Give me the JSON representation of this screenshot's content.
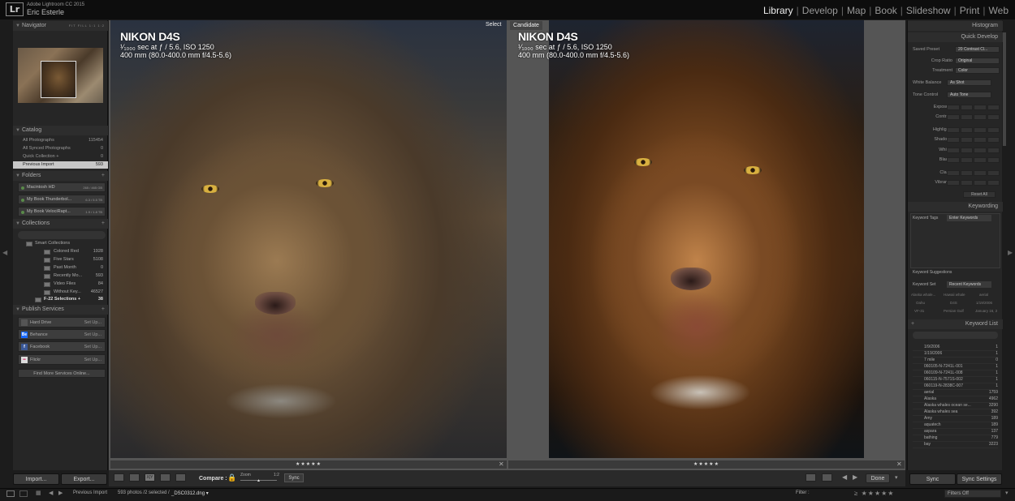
{
  "app": {
    "logo": "Lr",
    "title": "Adobe Lightroom CC 2015",
    "user": "Eric Esterle"
  },
  "modules": [
    {
      "label": "Library",
      "active": true
    },
    {
      "label": "Develop"
    },
    {
      "label": "Map"
    },
    {
      "label": "Book"
    },
    {
      "label": "Slideshow"
    },
    {
      "label": "Print"
    },
    {
      "label": "Web"
    }
  ],
  "navigator": {
    "title": "Navigator",
    "modes": "FIT FILL 1:1 1:2"
  },
  "catalog": {
    "title": "Catalog",
    "items": [
      {
        "label": "All Photographs",
        "count": "115454"
      },
      {
        "label": "All Synced Photographs",
        "count": "0"
      },
      {
        "label": "Quick Collection +",
        "count": "0"
      },
      {
        "label": "Previous Import",
        "count": "593",
        "selected": true
      }
    ]
  },
  "folders": {
    "title": "Folders",
    "items": [
      {
        "label": "Macintosh HD",
        "size": "265 / 465 GB"
      },
      {
        "label": "My Book Thunderbol...",
        "size": "6.3 / 5.5 TB"
      },
      {
        "label": "My Book VelociRapt...",
        "size": "1.9 / 1.8 TB"
      }
    ]
  },
  "collections": {
    "title": "Collections",
    "items": [
      {
        "label": "Smart Collections",
        "count": "",
        "indent": 1
      },
      {
        "label": "Colored Red",
        "count": "1928",
        "indent": 2
      },
      {
        "label": "Five Stars",
        "count": "5108",
        "indent": 2
      },
      {
        "label": "Past Month",
        "count": "0",
        "indent": 2
      },
      {
        "label": "Recently Mo...",
        "count": "593",
        "indent": 2
      },
      {
        "label": "Video Files",
        "count": "84",
        "indent": 2
      },
      {
        "label": "Without Key...",
        "count": "46527",
        "indent": 2
      },
      {
        "label": "F-22 Selections +",
        "count": "38",
        "indent": 1
      }
    ]
  },
  "publish": {
    "title": "Publish Services",
    "items": [
      {
        "label": "Hard Drive",
        "action": "Set Up...",
        "icon_color": "#555555",
        "icon": ""
      },
      {
        "label": "Behance",
        "action": "Set Up...",
        "icon_color": "#1769ff",
        "icon": "Be"
      },
      {
        "label": "Facebook",
        "action": "Set Up...",
        "icon_color": "#3b5998",
        "icon": "f"
      },
      {
        "label": "Flickr",
        "action": "Set Up...",
        "icon_color": "#dddddd",
        "icon": "••"
      }
    ],
    "find_more": "Find More Services Online..."
  },
  "left_buttons": {
    "import": "Import...",
    "export": "Export..."
  },
  "photos": {
    "left": {
      "camera": "NIKON D4S",
      "exposure": "¹⁄₁₀₀₀ sec at ƒ / 5.6, ISO 1250",
      "lens": "400 mm (80.0-400.0 mm f/4.5-5.6)",
      "tag": "Select"
    },
    "right": {
      "camera": "NIKON D4S",
      "exposure": "¹⁄₁₀₀₀ sec at ƒ / 5.6, ISO 1250",
      "lens": "400 mm (80.0-400.0 mm f/4.5-5.6)",
      "tag": "Candidate"
    }
  },
  "rating_strip": "★★★★★",
  "toolbar": {
    "compare": "Compare :",
    "zoom": "Zoom",
    "zoom_ratio": "1:2",
    "sync": "Sync",
    "done": "Done"
  },
  "right_panel": {
    "histogram": "Histogram",
    "quick_develop": {
      "title": "Quick Develop",
      "saved_preset_label": "Saved Preset",
      "saved_preset_value": "20 Contrast Cl...",
      "crop_label": "Crop Ratio",
      "crop_value": "Original",
      "treatment_label": "Treatment",
      "treatment_value": "Color",
      "wb_label": "White Balance",
      "wb_value": "As Shot",
      "tone_label": "Tone Control",
      "tone_value": "Auto Tone",
      "controls": [
        "Exposure",
        "Contrast",
        "Highlights",
        "Shadows",
        "Whites",
        "Blacks",
        "Clarity",
        "Vibrance"
      ],
      "reset": "Reset All"
    },
    "keywording": {
      "title": "Keywording",
      "tags_label": "Keyword Tags",
      "tags_value": "Enter Keywords",
      "suggestions": "Keyword Suggestions",
      "set_label": "Keyword Set",
      "set_value": "Recent Keywords",
      "set_items": [
        "Alaska whale...",
        "Hawaii whale",
        "aerial",
        "Oahu",
        "D4S",
        "1/19/2006",
        "VF-31",
        "Persian Gulf",
        "January 16, 2"
      ]
    },
    "keyword_list": {
      "title": "Keyword List",
      "items": [
        {
          "label": "1/9/2006",
          "count": "1"
        },
        {
          "label": "1/19/2006",
          "count": "1"
        },
        {
          "label": "7 mile",
          "count": "0"
        },
        {
          "label": "060105-N-7241L-001",
          "count": "1"
        },
        {
          "label": "060109-N-7241L-008",
          "count": "1"
        },
        {
          "label": "060115-N-7571S-002",
          "count": "1"
        },
        {
          "label": "060119-N-2838C-007",
          "count": "1"
        },
        {
          "label": "aerial",
          "count": "1759"
        },
        {
          "label": "Alaska",
          "count": "4962"
        },
        {
          "label": "Alaska whales ocean se...",
          "count": "3290"
        },
        {
          "label": "Alaska whales sea",
          "count": "392"
        },
        {
          "label": "Amy",
          "count": "189"
        },
        {
          "label": "aquatech",
          "count": "189"
        },
        {
          "label": "aspara",
          "count": "137"
        },
        {
          "label": "bathing",
          "count": "779"
        },
        {
          "label": "bay",
          "count": "3223"
        }
      ]
    },
    "sync": "Sync",
    "sync_settings": "Sync Settings"
  },
  "filmstrip": {
    "source": "Previous Import",
    "summary": "593 photos /2 selected /",
    "filename": "_DSC0312.dng ▾",
    "filter_label": "Filter :",
    "filter_stars": "≥ ★★★★★",
    "filters_off": "Filters Off"
  }
}
